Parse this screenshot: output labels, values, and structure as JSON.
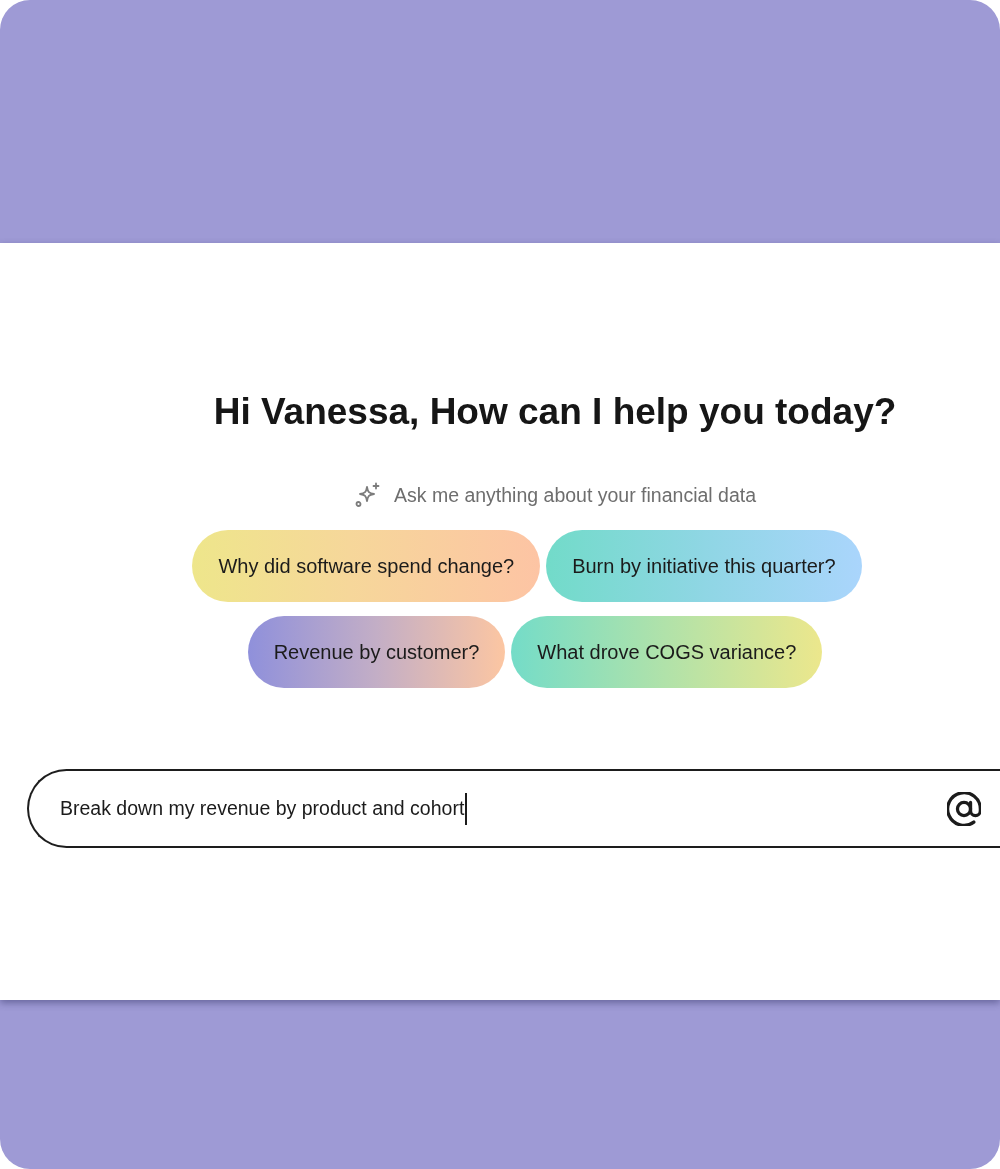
{
  "greeting": {
    "title": "Hi Vanessa, How can I help you today?",
    "subtitle": "Ask me anything about your financial data"
  },
  "suggestion_rows": [
    [
      {
        "label": "Why did software spend change?"
      },
      {
        "label": "Burn by initiative this quarter?"
      }
    ],
    [
      {
        "label": "Revenue by customer?"
      },
      {
        "label": "What drove COGS variance?"
      }
    ]
  ],
  "input": {
    "value": "Break down my revenue by product and cohort",
    "focused": true
  }
}
